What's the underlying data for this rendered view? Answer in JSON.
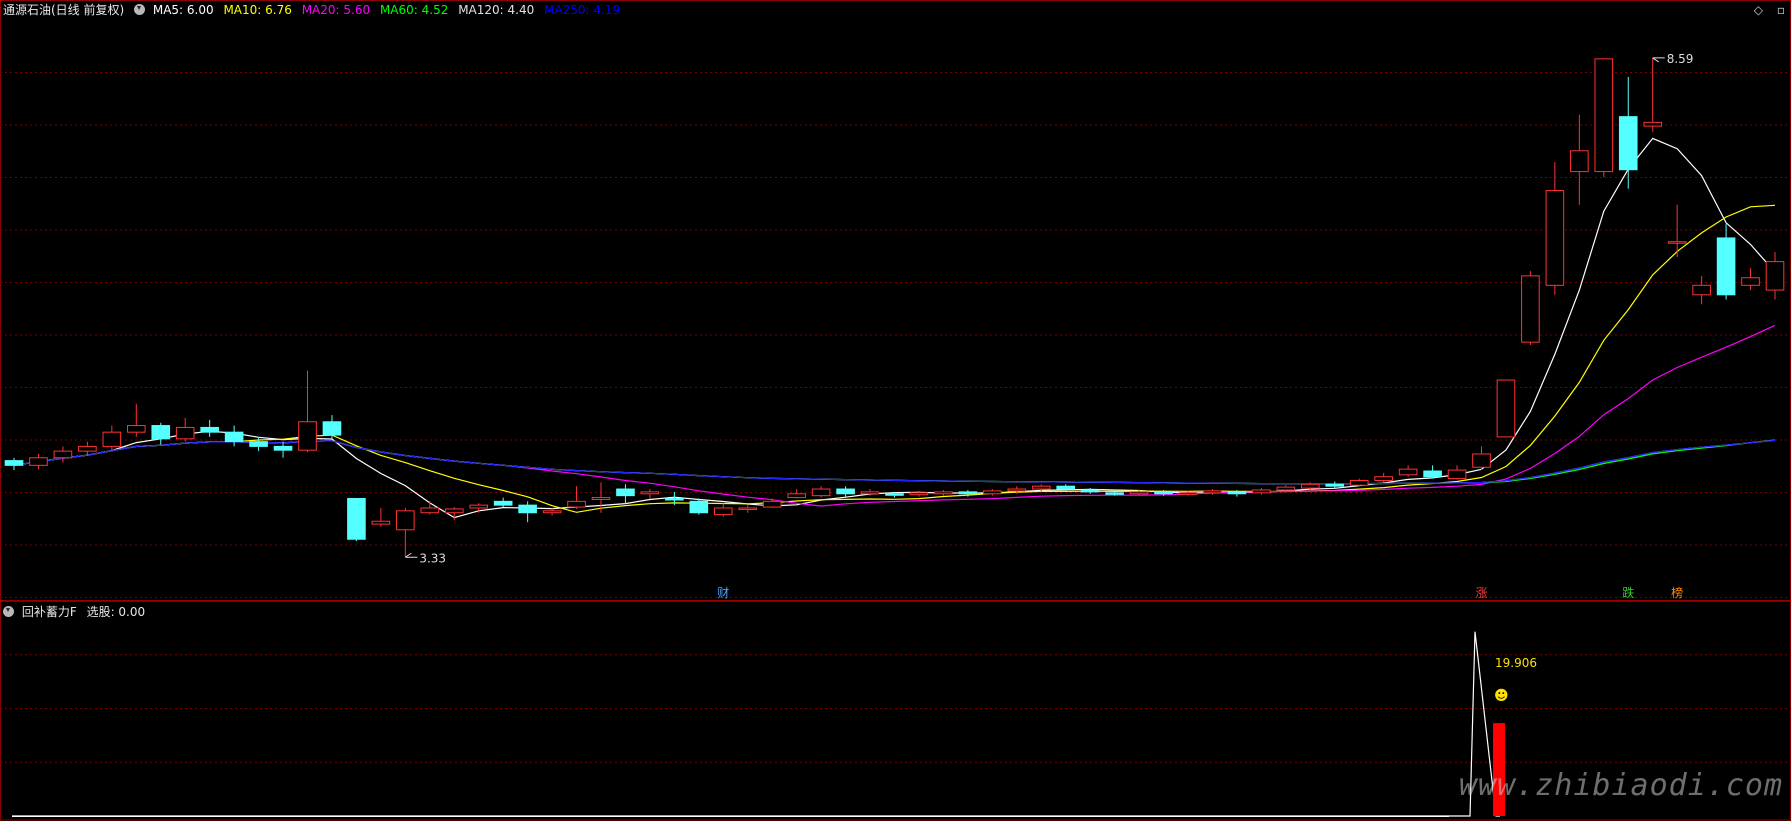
{
  "header": {
    "title": "通源石油(日线 前复权)",
    "ma_items": [
      {
        "label": "MA5: 6.00",
        "color": "#ffffff"
      },
      {
        "label": "MA10: 6.76",
        "color": "#ffff00"
      },
      {
        "label": "MA20: 5.60",
        "color": "#ff00ff"
      },
      {
        "label": "MA60: 4.52",
        "color": "#00ff00"
      },
      {
        "label": "MA120: 4.40",
        "color": "#e0e0e0"
      },
      {
        "label": "MA250: 4.19",
        "color": "#0000ff"
      }
    ]
  },
  "sub_header": {
    "indicator": "回补蓄力F",
    "value_label": "选股: 0.00"
  },
  "icons": {
    "top_right_1": "◇",
    "top_right_2": "▫"
  },
  "watermark": "www.zhibiaodi.com",
  "chart_data": [
    {
      "type": "candlestick",
      "title": "通源石油(日线 前复权)",
      "ylim": [
        2.9,
        9.0
      ],
      "annotations": [
        {
          "text": "8.59",
          "type": "high"
        },
        {
          "text": "3.33",
          "type": "low"
        },
        {
          "text": "财",
          "color": "#4aa3ff"
        },
        {
          "text": "涨",
          "color": "#ff3b3b"
        },
        {
          "text": "跌",
          "color": "#33cc33"
        },
        {
          "text": "榜",
          "color": "#ff8c00"
        }
      ],
      "candles": [
        [
          4.35,
          4.3,
          4.38,
          4.25
        ],
        [
          4.3,
          4.38,
          4.42,
          4.26
        ],
        [
          4.38,
          4.45,
          4.5,
          4.33
        ],
        [
          4.45,
          4.5,
          4.55,
          4.4
        ],
        [
          4.5,
          4.65,
          4.72,
          4.45
        ],
        [
          4.65,
          4.72,
          4.95,
          4.6
        ],
        [
          4.72,
          4.58,
          4.75,
          4.52
        ],
        [
          4.58,
          4.7,
          4.8,
          4.55
        ],
        [
          4.7,
          4.65,
          4.78,
          4.6
        ],
        [
          4.65,
          4.55,
          4.72,
          4.5
        ],
        [
          4.55,
          4.5,
          4.6,
          4.45
        ],
        [
          4.5,
          4.46,
          4.55,
          4.38
        ],
        [
          4.46,
          4.76,
          5.3,
          4.44
        ],
        [
          4.76,
          4.62,
          4.83,
          4.58
        ],
        [
          3.95,
          3.52,
          3.95,
          3.5
        ],
        [
          3.68,
          3.71,
          3.85,
          3.65
        ],
        [
          3.62,
          3.82,
          3.85,
          3.33
        ],
        [
          3.8,
          3.85,
          3.92,
          3.78
        ],
        [
          3.8,
          3.84,
          3.86,
          3.72
        ],
        [
          3.85,
          3.88,
          3.9,
          3.8
        ],
        [
          3.92,
          3.88,
          3.96,
          3.86
        ],
        [
          3.88,
          3.8,
          3.92,
          3.7
        ],
        [
          3.8,
          3.82,
          3.85,
          3.77
        ],
        [
          3.86,
          3.92,
          4.08,
          3.84
        ],
        [
          3.94,
          3.96,
          4.12,
          3.8
        ],
        [
          4.05,
          3.98,
          4.1,
          3.9
        ],
        [
          4.0,
          4.02,
          4.05,
          3.95
        ],
        [
          3.95,
          3.94,
          4.02,
          3.88
        ],
        [
          3.92,
          3.8,
          3.95,
          3.78
        ],
        [
          3.78,
          3.85,
          3.9,
          3.76
        ],
        [
          3.84,
          3.85,
          3.88,
          3.8
        ],
        [
          3.86,
          3.92,
          3.95,
          3.85
        ],
        [
          3.96,
          4.0,
          4.05,
          3.95
        ],
        [
          3.98,
          4.05,
          4.08,
          3.96
        ],
        [
          4.05,
          4.0,
          4.08,
          3.97
        ],
        [
          4.0,
          4.02,
          4.05,
          3.98
        ],
        [
          4.0,
          3.99,
          4.02,
          3.96
        ],
        [
          3.99,
          4.01,
          4.03,
          3.97
        ],
        [
          4.0,
          4.02,
          4.04,
          3.98
        ],
        [
          4.02,
          4.0,
          4.04,
          3.97
        ],
        [
          4.0,
          4.03,
          4.05,
          3.98
        ],
        [
          4.03,
          4.05,
          4.08,
          4.0
        ],
        [
          4.05,
          4.08,
          4.1,
          4.02
        ],
        [
          4.08,
          4.05,
          4.1,
          4.02
        ],
        [
          4.04,
          4.02,
          4.06,
          4.0
        ],
        [
          4.01,
          4.0,
          4.03,
          3.98
        ],
        [
          4.0,
          4.02,
          4.04,
          3.98
        ],
        [
          4.02,
          4.0,
          4.04,
          3.98
        ],
        [
          4.0,
          4.01,
          4.03,
          3.98
        ],
        [
          4.01,
          4.03,
          4.05,
          3.99
        ],
        [
          4.02,
          4.0,
          4.04,
          3.97
        ],
        [
          4.01,
          4.04,
          4.06,
          3.99
        ],
        [
          4.04,
          4.07,
          4.09,
          4.02
        ],
        [
          4.06,
          4.1,
          4.12,
          4.04
        ],
        [
          4.1,
          4.08,
          4.13,
          4.06
        ],
        [
          4.09,
          4.14,
          4.16,
          4.08
        ],
        [
          4.14,
          4.18,
          4.22,
          4.12
        ],
        [
          4.2,
          4.26,
          4.3,
          4.18
        ],
        [
          4.24,
          4.18,
          4.3,
          4.16
        ],
        [
          4.16,
          4.25,
          4.3,
          4.15
        ],
        [
          4.28,
          4.42,
          4.5,
          4.25
        ],
        [
          4.6,
          5.2,
          5.2,
          4.65
        ],
        [
          5.6,
          6.3,
          6.35,
          5.57
        ],
        [
          6.2,
          7.2,
          7.5,
          6.1
        ],
        [
          7.4,
          7.62,
          8.0,
          7.05
        ],
        [
          7.4,
          8.59,
          8.59,
          7.34
        ],
        [
          7.98,
          7.42,
          8.4,
          7.22
        ],
        [
          7.88,
          7.92,
          8.6,
          7.82
        ],
        [
          6.65,
          6.66,
          7.05,
          6.5
        ],
        [
          6.1,
          6.2,
          6.3,
          6.0
        ],
        [
          6.7,
          6.1,
          6.85,
          6.05
        ],
        [
          6.2,
          6.28,
          6.38,
          6.15
        ],
        [
          6.15,
          6.45,
          6.55,
          6.05
        ]
      ]
    },
    {
      "type": "line",
      "title": "回补蓄力F",
      "series": [
        {
          "name": "选股",
          "x": [
            0,
            58,
            59,
            60,
            61,
            62
          ],
          "values": [
            0,
            0,
            0,
            39.5,
            0,
            0
          ]
        }
      ],
      "bars": [
        {
          "x": 61,
          "value": 19.906,
          "color": "#ff0000"
        }
      ],
      "annotations": [
        {
          "text": "19.906",
          "color": "#ffe000"
        },
        {
          "text": "☻",
          "color": "#ffe000"
        }
      ]
    }
  ]
}
